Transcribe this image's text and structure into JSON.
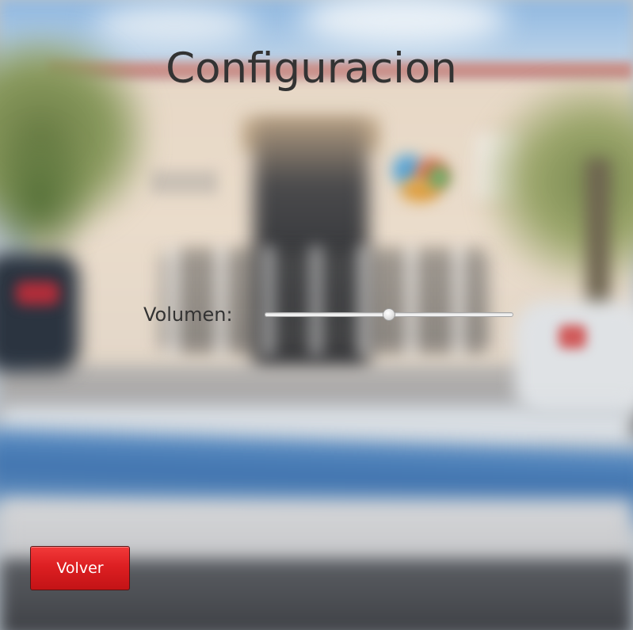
{
  "window": {
    "title": "Configuracion"
  },
  "settings": {
    "volume_label": "Volumen:",
    "volume_value": 0.5
  },
  "actions": {
    "back_label": "Volver"
  },
  "colors": {
    "title_text": "#333333",
    "back_button": "#dd1f22",
    "back_button_text": "#ffffff"
  }
}
